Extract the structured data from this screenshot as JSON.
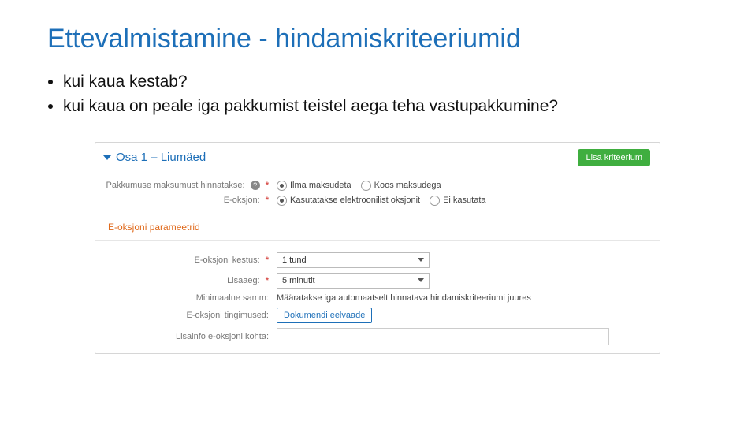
{
  "title": "Ettevalmistamine - hindamiskriteeriumid",
  "bullets": [
    "kui kaua kestab?",
    "kui kaua on peale iga pakkumist teistel aega teha vastupakkumine?"
  ],
  "panel": {
    "section_title": "Osa 1 – Liumäed",
    "add_criterion_label": "Lisa kriteerium",
    "row_price": {
      "label": "Pakkumuse maksumust hinnatakse:",
      "options": [
        "Ilma maksudeta",
        "Koos maksudega"
      ],
      "selected": 0
    },
    "row_eauction": {
      "label": "E-oksjon:",
      "options": [
        "Kasutatakse elektroonilist oksjonit",
        "Ei kasutata"
      ],
      "selected": 0
    },
    "params_header": "E-oksjoni parameetrid",
    "row_duration": {
      "label": "E-oksjoni kestus:",
      "value": "1 tund"
    },
    "row_extra": {
      "label": "Lisaaeg:",
      "value": "5 minutit"
    },
    "row_min_step": {
      "label": "Minimaalne samm:",
      "text": "Määratakse iga automaatselt hinnatava hindamiskriteeriumi juures"
    },
    "row_terms": {
      "label": "E-oksjoni tingimused:",
      "button": "Dokumendi eelvaade"
    },
    "row_extra_info": {
      "label": "Lisainfo e-oksjoni kohta:"
    }
  }
}
